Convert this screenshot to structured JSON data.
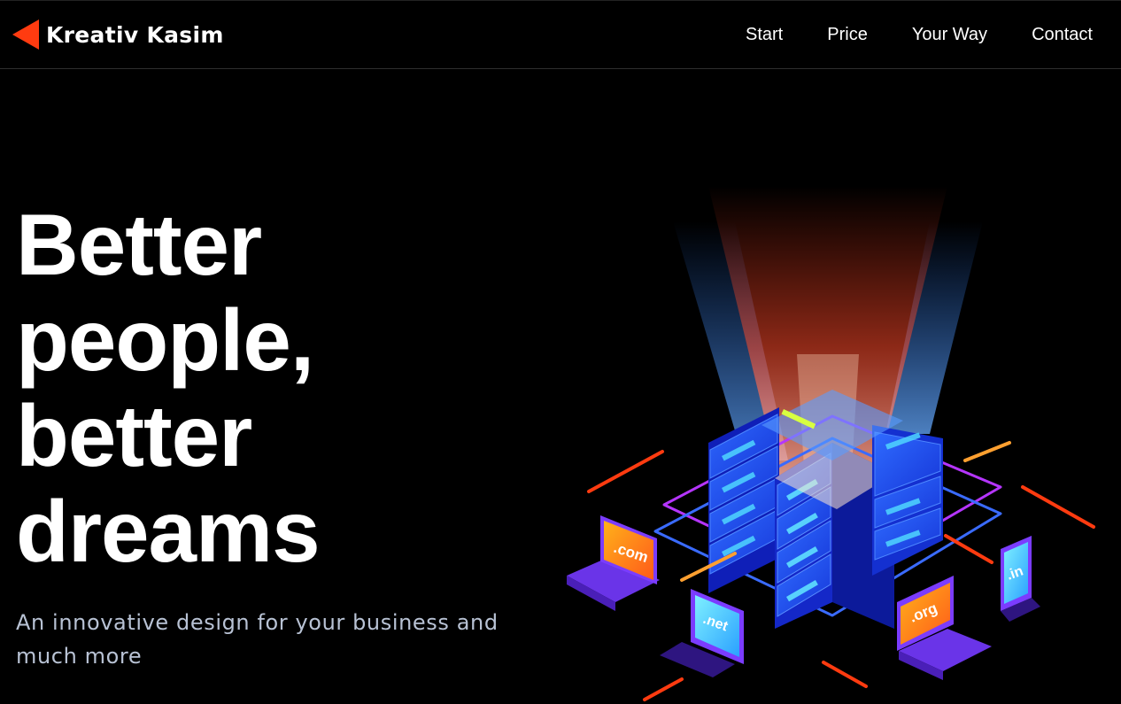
{
  "brand": {
    "name": "Kreativ Kasim",
    "logo_icon": "red-triangle-icon",
    "accent": "#ff3b10"
  },
  "nav": {
    "items": [
      "Start",
      "Price",
      "Your Way",
      "Contact"
    ]
  },
  "hero": {
    "title_lines": [
      "Better",
      "people,",
      "better",
      "dreams"
    ],
    "subtitle": "An innovative design for your business and much more"
  },
  "illustration": {
    "subject": "isometric server rack with devices",
    "device_labels": [
      ".com",
      ".net",
      ".org",
      ".in"
    ]
  },
  "colors": {
    "background": "#000000",
    "text": "#ffffff",
    "subtitle": "#b8c2d4",
    "server_blue": "#1a4dff",
    "glow_red": "#ff3b1a",
    "device_purple": "#7b3cff"
  }
}
